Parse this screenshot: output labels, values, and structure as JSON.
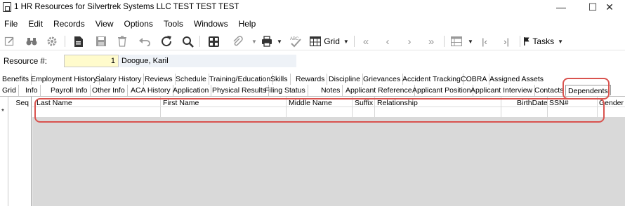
{
  "window": {
    "title": "1 HR Resources for Silvertrek Systems LLC TEST TEST TEST",
    "minimize": "—",
    "maximize": "☐",
    "close": "✕"
  },
  "menu": [
    "File",
    "Edit",
    "Records",
    "View",
    "Options",
    "Tools",
    "Windows",
    "Help"
  ],
  "toolbar": {
    "grid_label": "Grid",
    "tasks_label": "Tasks"
  },
  "resource": {
    "label": "Resource #:",
    "number": "1",
    "name": "Doogue, Karil"
  },
  "tabs_row1": [
    "Benefits",
    "Employment History",
    "Salary History",
    "Reviews",
    "Schedule",
    "Training/Education",
    "Skills",
    "Rewards",
    "Discipline",
    "Grievances",
    "Accident Tracking",
    "COBRA",
    "Assigned Assets"
  ],
  "tabs_row2": [
    "Grid",
    "Info",
    "Payroll Info",
    "Other Info",
    "ACA History",
    "Application",
    "Physical Results",
    "Filing Status",
    "Notes",
    "Applicant Reference",
    "Applicant Position",
    "Applicant Interview",
    "Contacts",
    "Dependents"
  ],
  "grid": {
    "row_marker": "*",
    "seq_header": "Seq",
    "columns": [
      "Last Name",
      "First Name",
      "Middle Name",
      "Suffix",
      "Relationship",
      "BirthDate",
      "SSN#",
      "Gender I"
    ]
  },
  "colors": {
    "callout": "#d9534f",
    "resource_number_bg": "#fffbcc",
    "grid_empty_bg": "#d9d9d9"
  }
}
